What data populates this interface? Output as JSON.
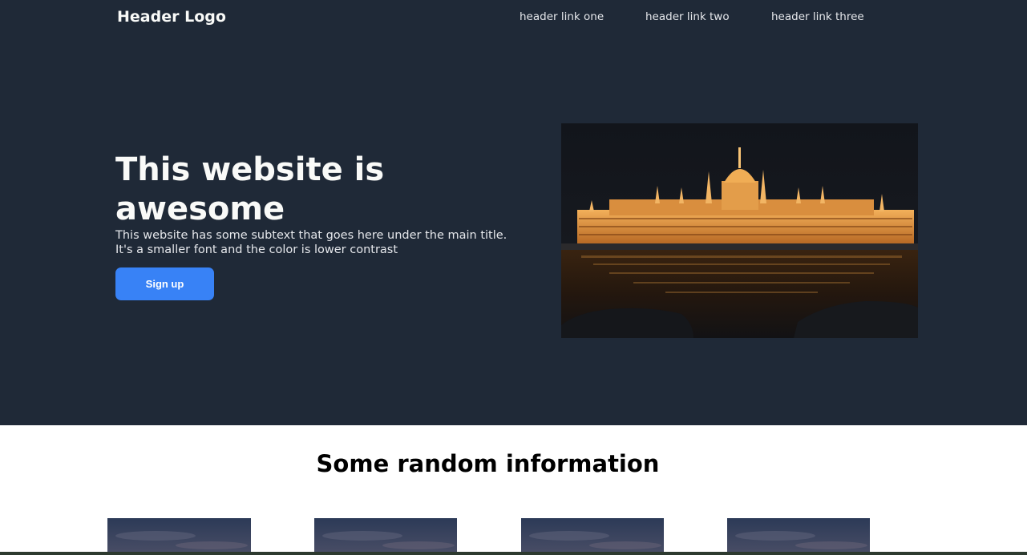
{
  "header": {
    "logo": "Header Logo",
    "links": [
      "header link one",
      "header link two",
      "header link three"
    ]
  },
  "hero": {
    "title": "This website is awesome",
    "subtitle_line1": "This website has some subtext that goes here under the main title.",
    "subtitle_line2": "It's a smaller font and the color is lower contrast",
    "button_label": "Sign up",
    "image_alt": "night-parliament-building-photo"
  },
  "info": {
    "title": "Some random information",
    "cards": [
      {
        "image": "sky-photo"
      },
      {
        "image": "sky-photo"
      },
      {
        "image": "sky-photo"
      },
      {
        "image": "sky-photo"
      }
    ]
  },
  "colors": {
    "hero_bg": "#1f2937",
    "button": "#3882f6",
    "heading_text": "#f9faf8",
    "sub_text": "#e5e7eb"
  }
}
